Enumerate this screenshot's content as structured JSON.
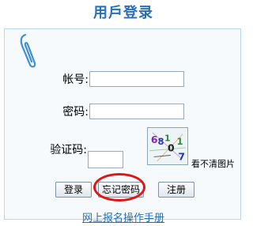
{
  "header": {
    "title": "用戶登录"
  },
  "form": {
    "account_label": "帐号:",
    "account_value": "",
    "password_label": "密码:",
    "password_value": "",
    "captcha_label": "验证码:",
    "captcha_value": "",
    "captcha_image_text": "68 1 0 1 7",
    "captcha_refresh": "看不清图片"
  },
  "buttons": {
    "login": "登录",
    "forgot_password": "忘记密码",
    "register": "注册"
  },
  "footer": {
    "manual_link": "网上报名操作手册"
  },
  "colors": {
    "title": "#2a6fb3",
    "link": "#1f6fbf",
    "highlight_ring": "#e01616",
    "panel_border": "#b9d6ef"
  },
  "icons": {
    "decoration": "paperclip-icon"
  }
}
